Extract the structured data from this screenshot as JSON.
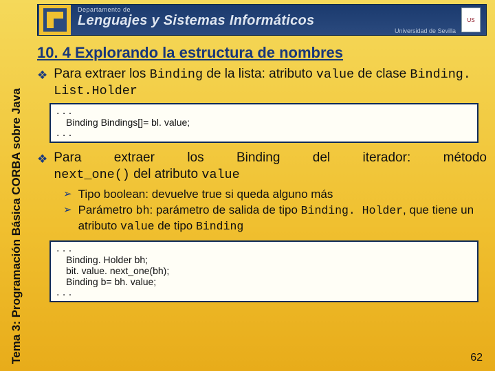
{
  "header": {
    "department": "Departamento de",
    "main": "Lenguajes y Sistemas Informáticos",
    "university": "Universidad de Sevilla",
    "crest": "US"
  },
  "sidebar": "Tema 3: Programación Básica CORBA sobre Java",
  "title": "10. 4 Explorando la estructura de nombres",
  "b1": {
    "pre": "Para extraer los ",
    "code1": "Binding",
    "mid": " de la lista: atributo ",
    "code2": "value",
    "post1": " de clase ",
    "code3": "Binding. List.Holder"
  },
  "code1": {
    "l1": ". . .",
    "l2": "Binding Bindings[]= bl. value;",
    "l3": ". . ."
  },
  "b2": {
    "w1": "Para",
    "w2": "extraer",
    "w3": "los",
    "w4": "Binding",
    "w5": "del",
    "w6": "iterador:",
    "w7": "método",
    "code1": "next_one()",
    "post1": " del atributo ",
    "code2": "value"
  },
  "s1": "Tipo boolean: devuelve true si queda alguno más",
  "s2": {
    "pre": "Parámetro ",
    "code1": "bh",
    "mid": ": parámetro de salida de tipo ",
    "code2": "Binding. Holder",
    "post1": ", que tiene un atributo ",
    "code3": "value",
    "post2": " de tipo ",
    "code4": "Binding"
  },
  "code2": {
    "l1": ". . .",
    "l2": "Binding. Holder bh;",
    "l3": "bit. value. next_one(bh);",
    "l4": "Binding b= bh. value;",
    "l5": ". . ."
  },
  "page": "62"
}
